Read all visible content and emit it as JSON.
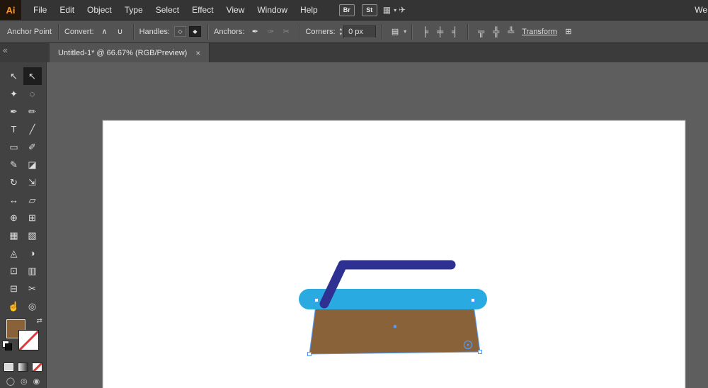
{
  "menubar": {
    "logo": "Ai",
    "menus": [
      "File",
      "Edit",
      "Object",
      "Type",
      "Select",
      "Effect",
      "View",
      "Window",
      "Help"
    ],
    "bridge_button": "Br",
    "stock_button": "St",
    "arrange_documents_glyph": "▦",
    "arrange_chevron_glyph": "▾",
    "gpu_glyph": "✈",
    "workspace_label": "We"
  },
  "controlbar": {
    "panel_title": "Anchor Point",
    "convert_label": "Convert:",
    "convert_icons": [
      {
        "name": "convert-to-corner-icon",
        "glyph": "∧"
      },
      {
        "name": "convert-to-smooth-icon",
        "glyph": "∪"
      }
    ],
    "handles_label": "Handles:",
    "handles_icons": [
      {
        "name": "show-handles-icon",
        "glyph": "◇"
      },
      {
        "name": "hide-handles-icon",
        "glyph": "◆",
        "selected": true
      }
    ],
    "anchors_label": "Anchors:",
    "anchors_icons": [
      {
        "name": "remove-anchor-icon",
        "glyph": "✒"
      },
      {
        "name": "connect-anchors-icon",
        "glyph": "✑",
        "disabled": true
      },
      {
        "name": "cut-path-icon",
        "glyph": "✂",
        "disabled": true
      }
    ],
    "corners_label": "Corners:",
    "stepper_up_glyph": "▴",
    "stepper_down_glyph": "▾",
    "corners_value": "0 px",
    "isolate_glyph": "▤",
    "isolate_chevron_glyph": "▾",
    "align_icons": [
      {
        "name": "align-left-icon",
        "glyph": "╞"
      },
      {
        "name": "align-center-icon",
        "glyph": "╪"
      },
      {
        "name": "align-right-icon",
        "glyph": "╡"
      },
      {
        "name": "align-top-icon",
        "glyph": "╦"
      },
      {
        "name": "align-middle-icon",
        "glyph": "╬"
      },
      {
        "name": "align-bottom-icon",
        "glyph": "╩"
      }
    ],
    "transform_label": "Transform",
    "free_transform_glyph": "⊞"
  },
  "tabbar": {
    "collapse_glyph": "«",
    "tab_title": "Untitled-1* @ 66.67% (RGB/Preview)",
    "close_glyph": "×"
  },
  "toolbar": {
    "tools": [
      {
        "name": "selection-tool",
        "glyph": "↖"
      },
      {
        "name": "direct-selection-tool",
        "glyph": "↖",
        "selected": true
      },
      {
        "name": "magic-wand-tool",
        "glyph": "✦"
      },
      {
        "name": "lasso-tool",
        "glyph": "◌"
      },
      {
        "name": "pen-tool",
        "glyph": "✒"
      },
      {
        "name": "curvature-tool",
        "glyph": "✏"
      },
      {
        "name": "type-tool",
        "glyph": "T"
      },
      {
        "name": "line-segment-tool",
        "glyph": "╱"
      },
      {
        "name": "rectangle-tool",
        "glyph": "▭"
      },
      {
        "name": "paintbrush-tool",
        "glyph": "✐"
      },
      {
        "name": "shaper-tool",
        "glyph": "✎"
      },
      {
        "name": "eraser-tool",
        "glyph": "◪"
      },
      {
        "name": "rotate-tool",
        "glyph": "↻"
      },
      {
        "name": "scale-tool",
        "glyph": "⇲"
      },
      {
        "name": "width-tool",
        "glyph": "↔"
      },
      {
        "name": "free-transform-tool",
        "glyph": "▱"
      },
      {
        "name": "shape-builder-tool",
        "glyph": "⊕"
      },
      {
        "name": "perspective-grid-tool",
        "glyph": "⊞"
      },
      {
        "name": "mesh-tool",
        "glyph": "▦"
      },
      {
        "name": "gradient-tool",
        "glyph": "▧"
      },
      {
        "name": "eyedropper-tool",
        "glyph": "◬"
      },
      {
        "name": "blend-tool",
        "glyph": "◑"
      },
      {
        "name": "symbol-sprayer-tool",
        "glyph": "⊡"
      },
      {
        "name": "column-graph-tool",
        "glyph": "▥"
      },
      {
        "name": "artboard-tool",
        "glyph": "⊟"
      },
      {
        "name": "slice-tool",
        "glyph": "✂"
      },
      {
        "name": "hand-tool",
        "glyph": "☝"
      },
      {
        "name": "zoom-tool",
        "glyph": "◎"
      }
    ],
    "swap_glyph": "⇄",
    "fill_color": "#8a6239",
    "drawing_modes": [
      {
        "name": "draw-normal-icon",
        "glyph": "◯"
      },
      {
        "name": "draw-behind-icon",
        "glyph": "◎"
      },
      {
        "name": "draw-inside-icon",
        "glyph": "◉"
      }
    ]
  },
  "artwork": {
    "artboard_color": "#ffffff",
    "handle_color": "#2e3192",
    "plate_color": "#29abe2",
    "body_color": "#8a6239",
    "selection_color": "#4f9bff"
  }
}
